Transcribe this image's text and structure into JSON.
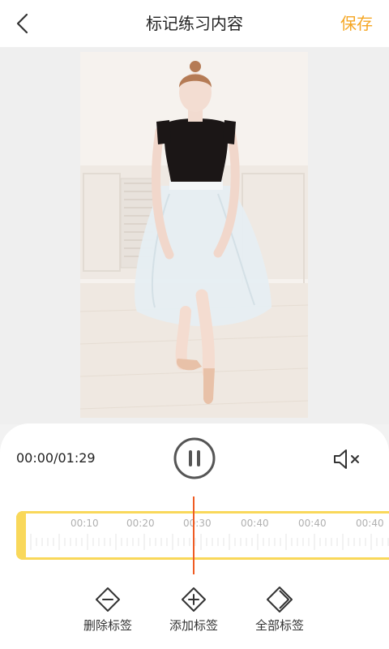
{
  "header": {
    "title": "标记练习内容",
    "save_label": "保存"
  },
  "player": {
    "time": "00:00/01:29"
  },
  "timeline": {
    "labels": [
      "00:10",
      "00:20",
      "00:30",
      "00:40",
      "00:40",
      "00:40"
    ]
  },
  "actions": [
    {
      "label": "删除标签"
    },
    {
      "label": "添加标签"
    },
    {
      "label": "全部标签"
    }
  ],
  "colors": {
    "accent": "#f5a623",
    "timeline_frame": "#f9d85a",
    "playhead": "#ef5b23"
  }
}
